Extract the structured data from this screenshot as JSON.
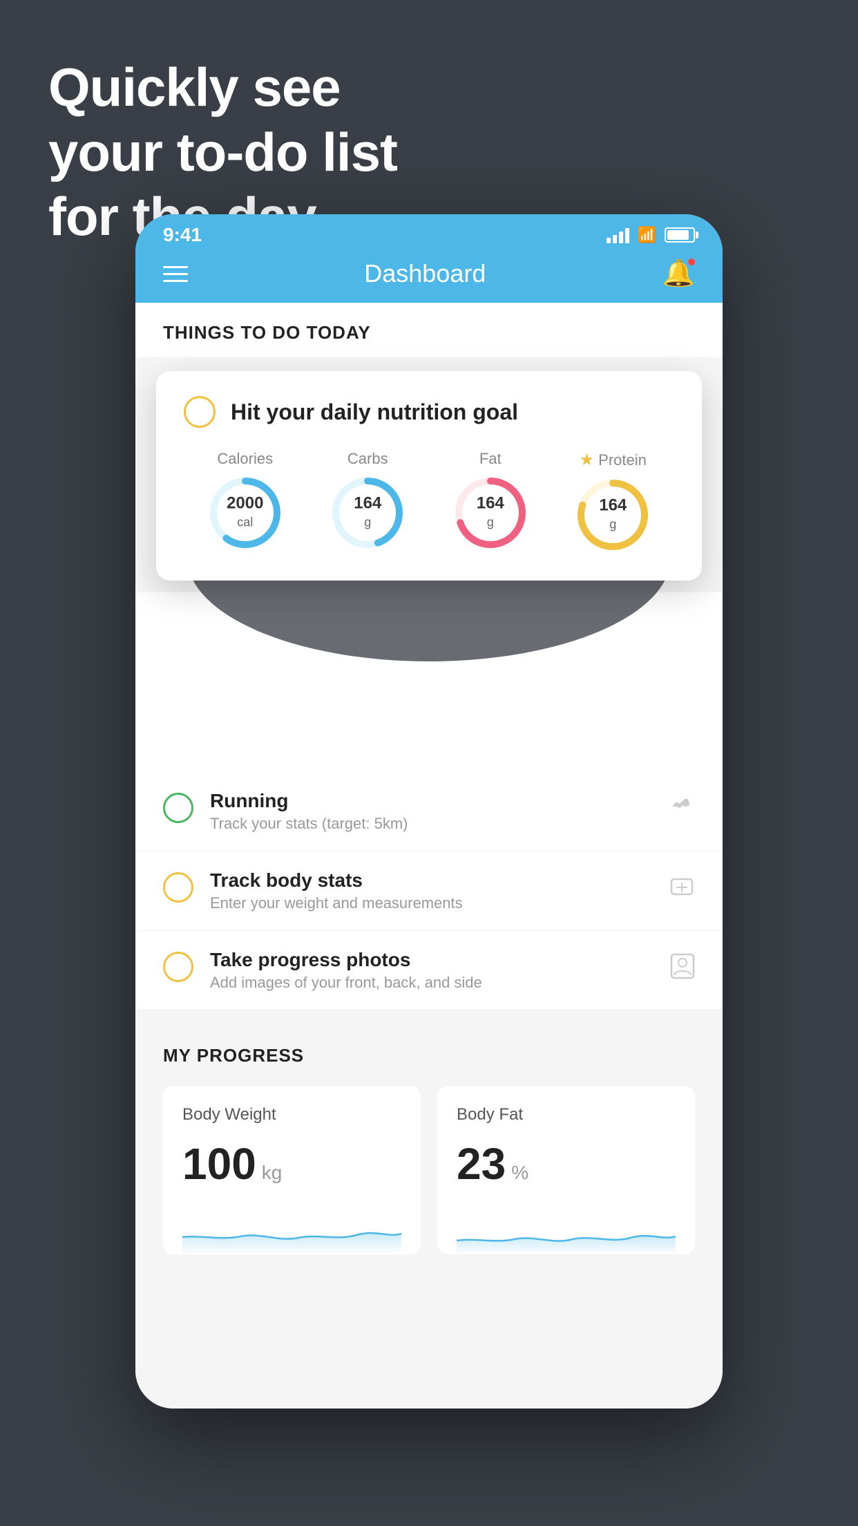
{
  "headline": {
    "line1": "Quickly see",
    "line2": "your to-do list",
    "line3": "for the day."
  },
  "status_bar": {
    "time": "9:41"
  },
  "nav": {
    "title": "Dashboard"
  },
  "things_section": {
    "title": "THINGS TO DO TODAY"
  },
  "floating_card": {
    "title": "Hit your daily nutrition goal",
    "nutrients": [
      {
        "label": "Calories",
        "value": "2000",
        "unit": "cal",
        "color": "#4db8e8",
        "trail": "#e0f5fc",
        "percent": 60
      },
      {
        "label": "Carbs",
        "value": "164",
        "unit": "g",
        "color": "#4db8e8",
        "trail": "#e0f5fc",
        "percent": 45
      },
      {
        "label": "Fat",
        "value": "164",
        "unit": "g",
        "color": "#f06080",
        "trail": "#fde8ec",
        "percent": 70
      },
      {
        "label": "Protein",
        "value": "164",
        "unit": "g",
        "color": "#f0c040",
        "trail": "#fef6dc",
        "percent": 80,
        "starred": true
      }
    ]
  },
  "todo_items": [
    {
      "name": "Running",
      "desc": "Track your stats (target: 5km)",
      "circle_color": "green",
      "icon": "shoe"
    },
    {
      "name": "Track body stats",
      "desc": "Enter your weight and measurements",
      "circle_color": "yellow",
      "icon": "scale"
    },
    {
      "name": "Take progress photos",
      "desc": "Add images of your front, back, and side",
      "circle_color": "yellow",
      "icon": "person"
    }
  ],
  "progress_section": {
    "title": "MY PROGRESS",
    "cards": [
      {
        "title": "Body Weight",
        "value": "100",
        "unit": "kg"
      },
      {
        "title": "Body Fat",
        "value": "23",
        "unit": "%"
      }
    ]
  }
}
